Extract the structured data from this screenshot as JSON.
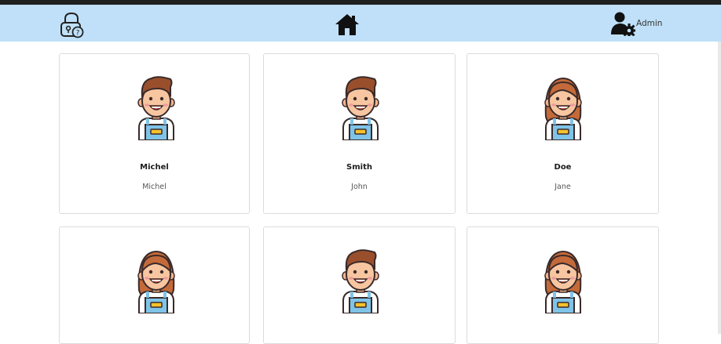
{
  "navbar": {
    "lock_icon": "lock-question-icon",
    "home_icon": "home-icon",
    "admin_icon": "user-gear-icon",
    "admin_label": "Admin",
    "background": "#bfe0f8"
  },
  "users": [
    {
      "last_name": "Michel",
      "first_name": "Michel",
      "avatar": "male"
    },
    {
      "last_name": "Smith",
      "first_name": "John",
      "avatar": "male"
    },
    {
      "last_name": "Doe",
      "first_name": "Jane",
      "avatar": "female"
    },
    {
      "last_name": "",
      "first_name": "",
      "avatar": "female"
    },
    {
      "last_name": "",
      "first_name": "",
      "avatar": "male"
    },
    {
      "last_name": "",
      "first_name": "",
      "avatar": "female"
    }
  ]
}
